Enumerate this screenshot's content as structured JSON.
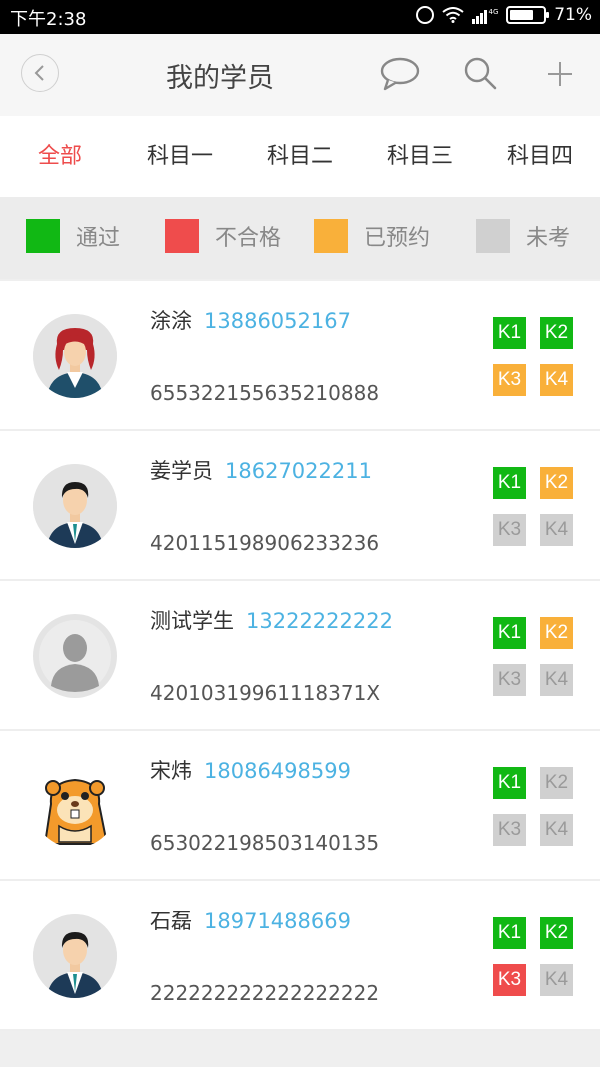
{
  "status_bar": {
    "time": "下午2:38",
    "network": "4G",
    "battery": "71%",
    "battery_level": 0.71
  },
  "header": {
    "title": "我的学员",
    "icons": [
      "back-icon",
      "message-icon",
      "search-icon",
      "add-icon"
    ]
  },
  "tabs": [
    {
      "label": "全部",
      "active": true
    },
    {
      "label": "科目一",
      "active": false
    },
    {
      "label": "科目二",
      "active": false
    },
    {
      "label": "科目三",
      "active": false
    },
    {
      "label": "科目四",
      "active": false
    }
  ],
  "legend": [
    {
      "label": "通过",
      "color": "#11b814"
    },
    {
      "label": "不合格",
      "color": "#ef4c4c"
    },
    {
      "label": "已预约",
      "color": "#f9b03a"
    },
    {
      "label": "未考",
      "color": "#d0d0d0"
    }
  ],
  "students": [
    {
      "name": "涂涂",
      "phone": "13886052167",
      "id_number": "655322155635210888",
      "avatar": "female-avatar",
      "subjects": [
        {
          "label": "K1",
          "status": "pass"
        },
        {
          "label": "K2",
          "status": "pass"
        },
        {
          "label": "K3",
          "status": "booked"
        },
        {
          "label": "K4",
          "status": "booked"
        }
      ]
    },
    {
      "name": "姜学员",
      "phone": "18627022211",
      "id_number": "420115198906233236",
      "avatar": "male-avatar",
      "subjects": [
        {
          "label": "K1",
          "status": "pass"
        },
        {
          "label": "K2",
          "status": "booked"
        },
        {
          "label": "K3",
          "status": "none"
        },
        {
          "label": "K4",
          "status": "none"
        }
      ]
    },
    {
      "name": "测试学生",
      "phone": "13222222222",
      "id_number": "42010319961118371X",
      "avatar": "default-avatar",
      "subjects": [
        {
          "label": "K1",
          "status": "pass"
        },
        {
          "label": "K2",
          "status": "booked"
        },
        {
          "label": "K3",
          "status": "none"
        },
        {
          "label": "K4",
          "status": "none"
        }
      ]
    },
    {
      "name": "宋炜",
      "phone": "18086498599",
      "id_number": "653022198503140135",
      "avatar": "hamster-avatar",
      "subjects": [
        {
          "label": "K1",
          "status": "pass"
        },
        {
          "label": "K2",
          "status": "none"
        },
        {
          "label": "K3",
          "status": "none"
        },
        {
          "label": "K4",
          "status": "none"
        }
      ]
    },
    {
      "name": "石磊",
      "phone": "18971488669",
      "id_number": "222222222222222222",
      "avatar": "male-avatar",
      "subjects": [
        {
          "label": "K1",
          "status": "pass"
        },
        {
          "label": "K2",
          "status": "pass"
        },
        {
          "label": "K3",
          "status": "fail"
        },
        {
          "label": "K4",
          "status": "none"
        }
      ]
    }
  ]
}
